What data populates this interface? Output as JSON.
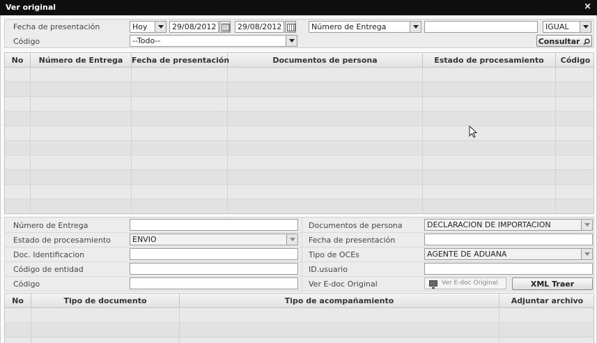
{
  "window": {
    "title": "Ver original",
    "close_glyph": "×"
  },
  "filter": {
    "fecha_label": "Fecha de presentación",
    "period_value": "Hoy",
    "date_from": "29/08/2012",
    "date_to": "29/08/2012",
    "search_field_value": "Número de Entrega",
    "search_text": "",
    "operator_value": "IGUAL",
    "codigo_label": "Código",
    "codigo_value": "--Todo--",
    "consultar_label": "Consultar"
  },
  "results_table": {
    "columns": [
      "No",
      "Número de Entrega",
      "Fecha de presentación",
      "Documentos de persona",
      "Estado de procesamiento",
      "Código"
    ],
    "rows": []
  },
  "detail": {
    "numero_entrega_label": "Número de Entrega",
    "numero_entrega_value": "",
    "estado_label": "Estado de procesamiento",
    "estado_value": "ENVIO",
    "doc_ident_label": "Doc. Identificacion",
    "doc_ident_value": "",
    "codigo_entidad_label": "Código de entidad",
    "codigo_entidad_value": "",
    "codigo_label": "Código",
    "codigo_value": "",
    "documentos_persona_label": "Documentos de persona",
    "documentos_persona_value": "DECLARACION DE IMPORTACION",
    "fecha_presentacion_label": "Fecha de presentación",
    "fecha_presentacion_value": "",
    "tipo_oces_label": "Tipo de OCEs",
    "tipo_oces_value": "AGENTE DE ADUANA",
    "id_usuario_label": "ID.usuario",
    "id_usuario_value": "",
    "ver_edoc_label": "Ver E-doc Original",
    "ver_edoc_button": "Ver E-doc Original",
    "xml_button": "XML Traer"
  },
  "attachments_table": {
    "columns": [
      "No",
      "Tipo de documento",
      "Tipo de acompañamiento",
      "Adjuntar archivo"
    ],
    "rows": []
  }
}
